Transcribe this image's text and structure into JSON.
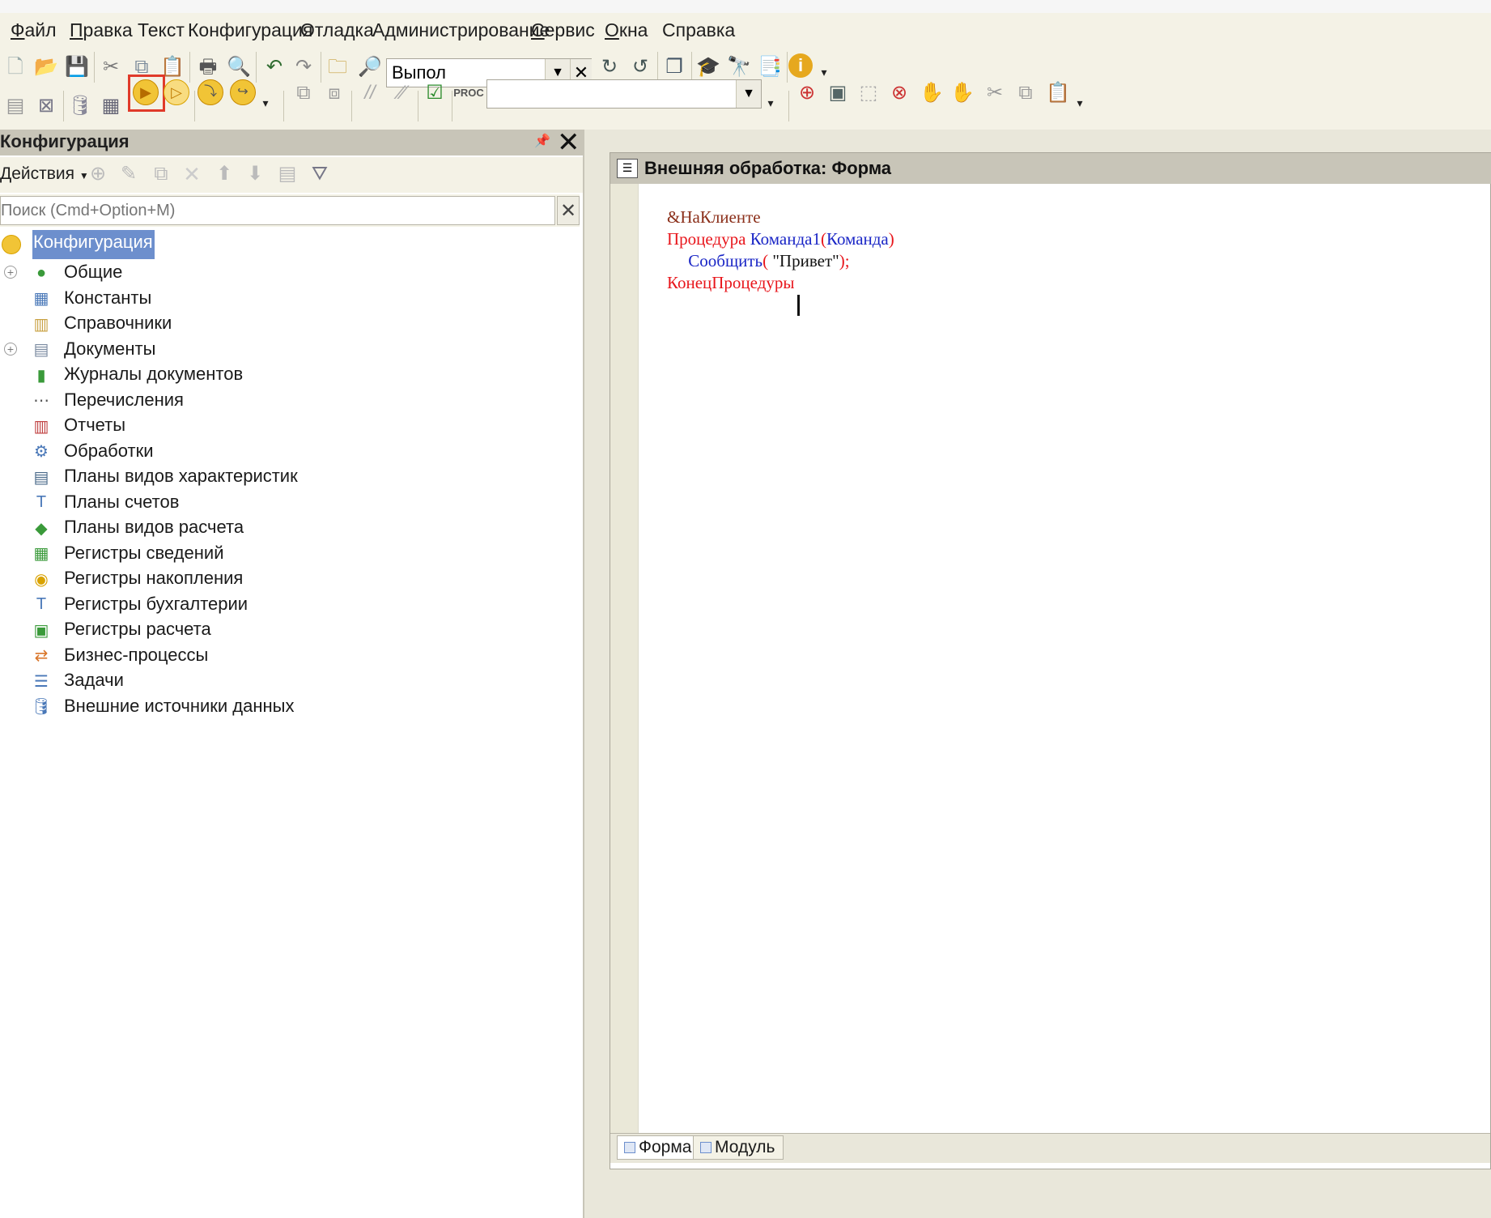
{
  "menu": {
    "file": "Файл",
    "edit": "Правка",
    "text": "Текст",
    "config": "Конфигурация",
    "debug": "Отладка",
    "admin": "Администрирование",
    "service": "Сервис",
    "windows": "Окна",
    "help": "Справка"
  },
  "toolbar": {
    "search_value": "Выпол",
    "combo2_value": ""
  },
  "config_panel": {
    "title": "Конфигурация",
    "actions_label": "Действия",
    "search_placeholder": "Поиск (Cmd+Option+M)",
    "root_label": "Конфигурация",
    "items": [
      {
        "label": "Общие",
        "icon": "common-icon",
        "expandable": true
      },
      {
        "label": "Константы",
        "icon": "constants-icon",
        "expandable": false
      },
      {
        "label": "Справочники",
        "icon": "catalogs-icon",
        "expandable": false
      },
      {
        "label": "Документы",
        "icon": "documents-icon",
        "expandable": true
      },
      {
        "label": "Журналы документов",
        "icon": "journals-icon",
        "expandable": false
      },
      {
        "label": "Перечисления",
        "icon": "enums-icon",
        "expandable": false
      },
      {
        "label": "Отчеты",
        "icon": "reports-icon",
        "expandable": false
      },
      {
        "label": "Обработки",
        "icon": "processing-icon",
        "expandable": false
      },
      {
        "label": "Планы видов характеристик",
        "icon": "char-types-icon",
        "expandable": false
      },
      {
        "label": "Планы счетов",
        "icon": "accounts-icon",
        "expandable": false
      },
      {
        "label": "Планы видов расчета",
        "icon": "calc-types-icon",
        "expandable": false
      },
      {
        "label": "Регистры сведений",
        "icon": "info-registers-icon",
        "expandable": false
      },
      {
        "label": "Регистры накопления",
        "icon": "accum-registers-icon",
        "expandable": false
      },
      {
        "label": "Регистры бухгалтерии",
        "icon": "accounting-registers-icon",
        "expandable": false
      },
      {
        "label": "Регистры расчета",
        "icon": "calc-registers-icon",
        "expandable": false
      },
      {
        "label": "Бизнес-процессы",
        "icon": "business-processes-icon",
        "expandable": false
      },
      {
        "label": "Задачи",
        "icon": "tasks-icon",
        "expandable": false
      },
      {
        "label": "Внешние источники данных",
        "icon": "external-sources-icon",
        "expandable": false
      }
    ]
  },
  "editor": {
    "title": "Внешняя обработка: Форма",
    "code": {
      "line1": "&НаКлиенте",
      "line2_kw": "Процедура",
      "line2_name": "Команда1",
      "line2_open": "(",
      "line2_param": "Команда",
      "line2_close": ")",
      "line3_indent": "     ",
      "line3_call": "Сообщить",
      "line3_open": "( ",
      "line3_str": "\"Привет\"",
      "line3_close": ");",
      "line4": "КонецПроцедуры"
    },
    "tabs": {
      "form": "Форма",
      "module": "Модуль"
    }
  },
  "colors": {
    "background": "#f4f2e6",
    "panel_header": "#c8c5b8",
    "selection": "#6d8fcd",
    "keyword": "#e8151b",
    "identifier": "#1a26c6",
    "directive": "#8b2f1a",
    "highlight_box": "#e03a2a"
  }
}
